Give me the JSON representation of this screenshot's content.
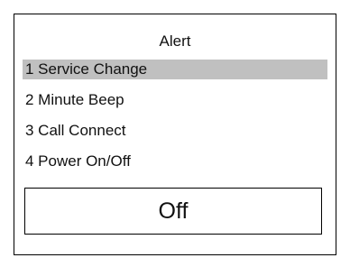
{
  "screen": {
    "title": "Alert",
    "menu": {
      "selected_index": 0,
      "items": [
        {
          "label": "1 Service Change"
        },
        {
          "label": "2 Minute Beep"
        },
        {
          "label": "3 Call Connect"
        },
        {
          "label": "4 Power On/Off"
        }
      ]
    },
    "value_display": "Off"
  },
  "colors": {
    "selection_highlight": "#c0c0c0",
    "border": "#000000",
    "background": "#ffffff"
  }
}
